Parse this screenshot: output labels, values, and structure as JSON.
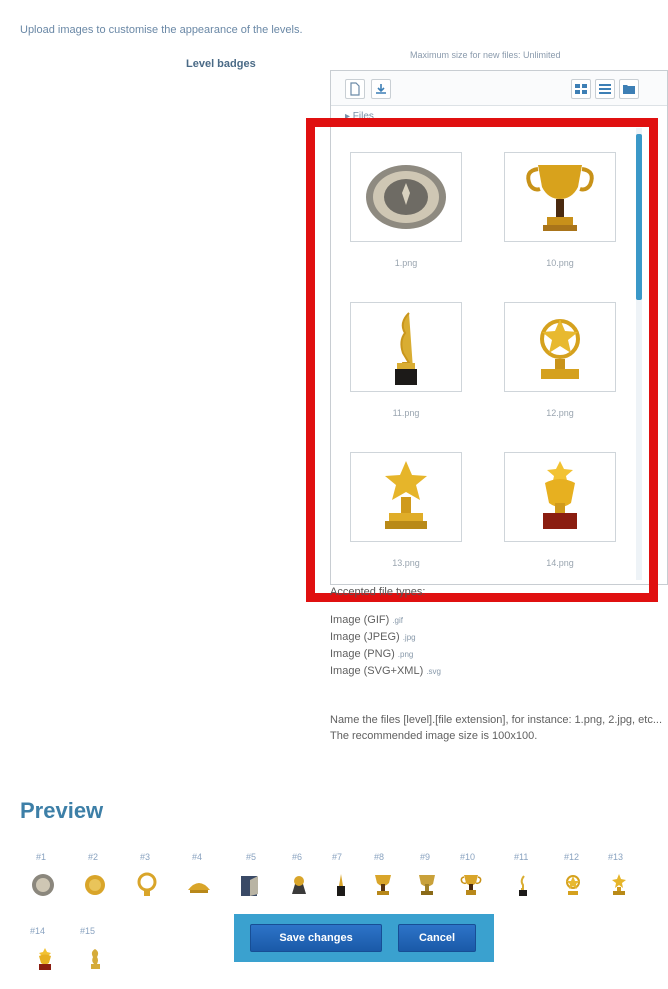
{
  "intro_text": "Upload images to customise the appearance of the levels.",
  "level_badges_label": "Level badges",
  "max_size_text": "Maximum size for new files: Unlimited",
  "filepicker": {
    "path_text": "▸ Files",
    "files": [
      "1.png",
      "10.png",
      "11.png",
      "12.png",
      "13.png",
      "14.png"
    ]
  },
  "accepted": {
    "heading": "Accepted file types:",
    "types": [
      {
        "label": "Image (GIF)",
        "ext": ".gif"
      },
      {
        "label": "Image (JPEG)",
        "ext": ".jpg"
      },
      {
        "label": "Image (PNG)",
        "ext": ".png"
      },
      {
        "label": "Image (SVG+XML)",
        "ext": ".svg"
      }
    ],
    "note": "Name the files [level].[file extension], for instance: 1.png, 2.jpg, etc... The recommended image size is 100x100."
  },
  "preview": {
    "title": "Preview",
    "badges": [
      "#1",
      "#2",
      "#3",
      "#4",
      "#5",
      "#6",
      "#7",
      "#8",
      "#9",
      "#10",
      "#11",
      "#12",
      "#13",
      "#14",
      "#15"
    ]
  },
  "buttons": {
    "save": "Save changes",
    "cancel": "Cancel"
  },
  "colors": {
    "highlight": "#e01010",
    "accent": "#3aa1cf",
    "title": "#3d7fa7"
  }
}
